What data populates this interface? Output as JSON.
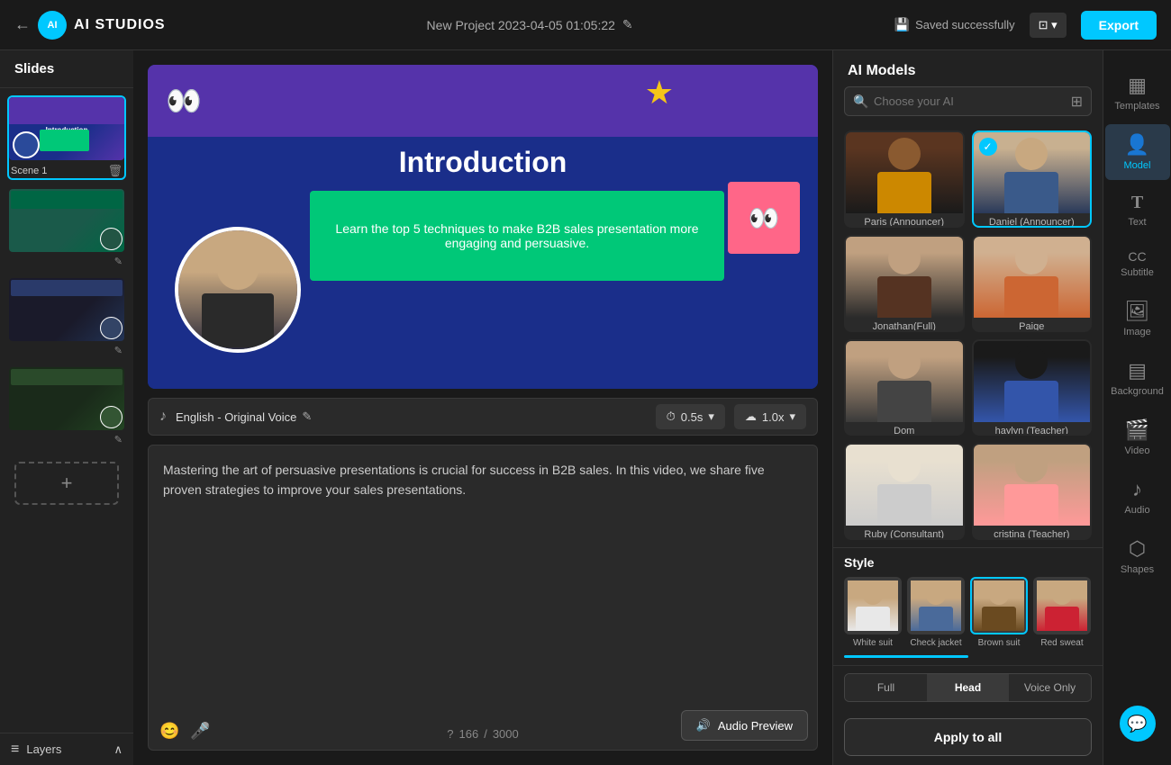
{
  "app": {
    "logo": "AI STUDIOS",
    "back_icon": "←"
  },
  "topbar": {
    "project_name": "New Project 2023-04-05 01:05:22",
    "edit_icon": "✎",
    "saved_status": "Saved successfully",
    "view_label": "⊡",
    "export_label": "Export"
  },
  "slides_panel": {
    "header": "Slides",
    "scenes": [
      {
        "label": "Scene 1"
      },
      {
        "label": ""
      },
      {
        "label": ""
      },
      {
        "label": ""
      }
    ],
    "add_slide_icon": "+"
  },
  "layers": {
    "label": "Layers",
    "chevron": "∧"
  },
  "canvas": {
    "title": "Introduction",
    "subtitle": "Learn the top 5 techniques to make B2B sales presentation more engaging and persuasive."
  },
  "voice_bar": {
    "language": "English - Original Voice",
    "music_icon": "♪",
    "voice_edit_icon": "✎",
    "timing": "0.5s",
    "timing_icon": "⏱",
    "speed": "1.0x",
    "speed_icon": "☁"
  },
  "text_editor": {
    "content": "Mastering the art of persuasive presentations is crucial for success in B2B sales. In this video, we share five proven strategies to improve your sales presentations.",
    "char_count": "166",
    "char_max": "3000",
    "help_icon": "?",
    "emoji_icon": "😊",
    "mic_icon": "🎤",
    "audio_preview": "Audio Preview",
    "audio_icon": "🔊"
  },
  "ai_panel": {
    "title": "AI Models",
    "search_placeholder": "Choose your AI",
    "filter_icon": "⊞",
    "models": [
      {
        "name": "Paris (Announcer)",
        "type": "paris"
      },
      {
        "name": "Daniel (Announcer)",
        "type": "daniel",
        "selected": true
      },
      {
        "name": "Jonathan(Full) (Consultant)",
        "type": "jonathan"
      },
      {
        "name": "Paige",
        "type": "paige"
      },
      {
        "name": "Dom",
        "type": "dom"
      },
      {
        "name": "haylyn (Teacher)",
        "type": "haylyn"
      },
      {
        "name": "Ruby (Consultant)",
        "type": "ruby"
      },
      {
        "name": "cristina (Teacher)",
        "type": "cristina"
      }
    ],
    "style_section": {
      "title": "Style",
      "styles": [
        {
          "label": "White suit",
          "type": "white"
        },
        {
          "label": "Check jacket",
          "type": "check"
        },
        {
          "label": "Brown suit",
          "type": "brown",
          "selected": true
        },
        {
          "label": "Red sweat",
          "type": "red"
        }
      ]
    },
    "position": {
      "buttons": [
        {
          "label": "Full",
          "active": false
        },
        {
          "label": "Head",
          "active": true
        },
        {
          "label": "Voice Only",
          "active": false
        }
      ]
    },
    "apply_label": "Apply to all"
  },
  "right_icons": [
    {
      "icon": "▦",
      "label": "Templates",
      "active": false
    },
    {
      "icon": "👤",
      "label": "Model",
      "active": true
    },
    {
      "icon": "T",
      "label": "Text",
      "active": false
    },
    {
      "icon": "CC",
      "label": "Subtitle",
      "active": false
    },
    {
      "icon": "🖼",
      "label": "Image",
      "active": false
    },
    {
      "icon": "▤",
      "label": "Background",
      "active": false
    },
    {
      "icon": "🎬",
      "label": "Video",
      "active": false
    },
    {
      "icon": "♪",
      "label": "Audio",
      "active": false
    },
    {
      "icon": "⬡",
      "label": "Shapes",
      "active": false
    }
  ]
}
